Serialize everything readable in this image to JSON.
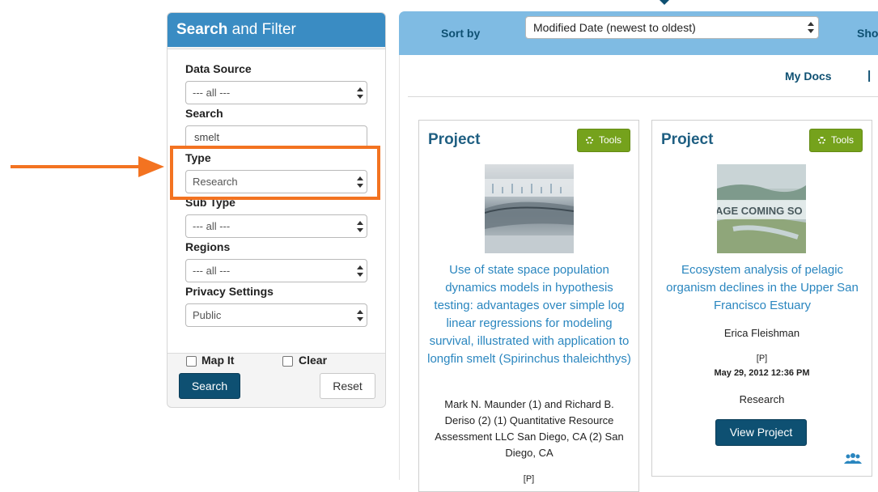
{
  "sidebar": {
    "title_bold": "Search",
    "title_rest": "and Filter",
    "filters": {
      "data_source": {
        "label": "Data Source",
        "value": "--- all ---"
      },
      "search": {
        "label": "Search",
        "value": "smelt"
      },
      "type": {
        "label": "Type",
        "value": "Research"
      },
      "sub_type": {
        "label": "Sub Type",
        "value": "--- all ---"
      },
      "regions": {
        "label": "Regions",
        "value": "--- all ---"
      },
      "privacy": {
        "label": "Privacy Settings",
        "value": "Public"
      }
    },
    "map_it_label": "Map It",
    "clear_label": "Clear",
    "search_button": "Search",
    "reset_button": "Reset"
  },
  "toolbar": {
    "sort_label": "Sort by",
    "sort_value": "Modified Date (newest to oldest)",
    "show_label": "Show",
    "my_docs": "My Docs",
    "separator": "|"
  },
  "cards": [
    {
      "type": "Project",
      "tools": "Tools",
      "title": "Use of state space population dynamics models in hypothesis testing: advantages over simple log linear regressions for modeling survival, illustrated with application to longfin smelt (Spirinchus thaleichthys)",
      "authors": "Mark N. Maunder (1) and Richard B. Deriso (2) (1) Quantitative Resource Assessment LLC San Diego, CA (2) San Diego, CA",
      "privacy_flag": "[P]"
    },
    {
      "type": "Project",
      "tools": "Tools",
      "image_text": "AGE COMING SO",
      "title": "Ecosystem analysis of pelagic organism declines in the Upper San Francisco Estuary",
      "authors": "Erica Fleishman",
      "privacy_flag": "[P]",
      "date": "May 29, 2012 12:36 PM",
      "category": "Research",
      "view_button": "View Project"
    }
  ],
  "colors": {
    "accent_blue": "#3a8cc3",
    "dark_blue": "#0e5072",
    "tools_green": "#75a21c",
    "highlight_orange": "#f37321",
    "link_blue": "#2a86bf"
  }
}
